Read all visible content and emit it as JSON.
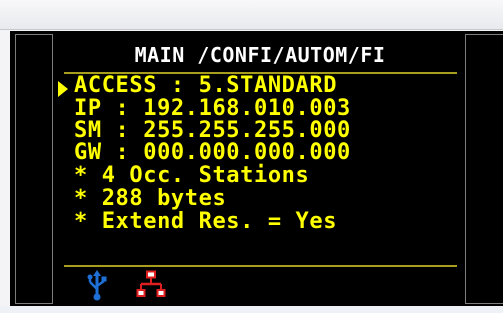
{
  "screen": {
    "title": "MAIN /CONFI/AUTOM/FI",
    "lines": [
      "ACCESS : 5.STANDARD",
      "IP : 192.168.010.003",
      "SM : 255.255.255.000",
      "GW : 000.000.000.000",
      "* 4 Occ. Stations",
      "* 288 bytes",
      "* Extend Res. = Yes"
    ],
    "selected_line_index": 0
  },
  "status_icons": [
    "usb-icon",
    "network-icon"
  ],
  "colors": {
    "background": "#000000",
    "text": "#ffff00",
    "title": "#ffffff",
    "rule": "#a99d1e",
    "usb": "#1e6fd6",
    "network": "#e02020"
  }
}
